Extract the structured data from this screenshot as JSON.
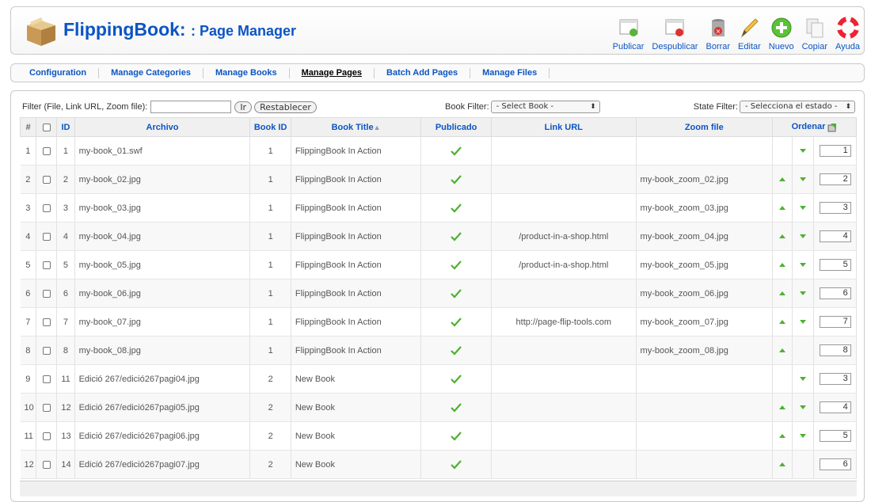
{
  "header": {
    "title": "FlippingBook:",
    "subtitle": ": Page Manager",
    "toolbar": [
      {
        "label": "Publicar",
        "icon": "publish-icon"
      },
      {
        "label": "Despublicar",
        "icon": "unpublish-icon"
      },
      {
        "label": "Borrar",
        "icon": "trash-icon"
      },
      {
        "label": "Editar",
        "icon": "pencil-icon"
      },
      {
        "label": "Nuevo",
        "icon": "plus-circle-icon"
      },
      {
        "label": "Copiar",
        "icon": "copy-icon"
      },
      {
        "label": "Ayuda",
        "icon": "lifebuoy-icon"
      }
    ]
  },
  "submenu": {
    "tabs": [
      {
        "label": "Configuration"
      },
      {
        "label": "Manage Categories"
      },
      {
        "label": "Manage Books"
      },
      {
        "label": "Manage Pages"
      },
      {
        "label": "Batch Add Pages"
      },
      {
        "label": "Manage Files"
      }
    ],
    "active": "Manage Pages"
  },
  "filters": {
    "filter_label": "Filter (File, Link URL, Zoom file):",
    "filter_value": "",
    "go_label": "Ir",
    "reset_label": "Restablecer",
    "book_filter_label": "Book Filter:",
    "book_filter_value": "- Select Book -",
    "state_filter_label": "State Filter:",
    "state_filter_value": "- Selecciona el estado -"
  },
  "table": {
    "headers": {
      "num": "#",
      "id": "ID",
      "file": "Archivo",
      "book_id": "Book ID",
      "book_title": "Book Title",
      "published": "Publicado",
      "link_url": "Link URL",
      "zoom_file": "Zoom file",
      "order": "Ordenar"
    },
    "rows": [
      {
        "num": "1",
        "id": "1",
        "file": "my-book_01.swf",
        "book_id": "1",
        "book_title": "FlippingBook In Action",
        "link_url": "",
        "zoom_file": "",
        "up": false,
        "down": true,
        "order": "1"
      },
      {
        "num": "2",
        "id": "2",
        "file": "my-book_02.jpg",
        "book_id": "1",
        "book_title": "FlippingBook In Action",
        "link_url": "",
        "zoom_file": "my-book_zoom_02.jpg",
        "up": true,
        "down": true,
        "order": "2"
      },
      {
        "num": "3",
        "id": "3",
        "file": "my-book_03.jpg",
        "book_id": "1",
        "book_title": "FlippingBook In Action",
        "link_url": "",
        "zoom_file": "my-book_zoom_03.jpg",
        "up": true,
        "down": true,
        "order": "3"
      },
      {
        "num": "4",
        "id": "4",
        "file": "my-book_04.jpg",
        "book_id": "1",
        "book_title": "FlippingBook In Action",
        "link_url": "/product-in-a-shop.html",
        "zoom_file": "my-book_zoom_04.jpg",
        "up": true,
        "down": true,
        "order": "4"
      },
      {
        "num": "5",
        "id": "5",
        "file": "my-book_05.jpg",
        "book_id": "1",
        "book_title": "FlippingBook In Action",
        "link_url": "/product-in-a-shop.html",
        "zoom_file": "my-book_zoom_05.jpg",
        "up": true,
        "down": true,
        "order": "5"
      },
      {
        "num": "6",
        "id": "6",
        "file": "my-book_06.jpg",
        "book_id": "1",
        "book_title": "FlippingBook In Action",
        "link_url": "",
        "zoom_file": "my-book_zoom_06.jpg",
        "up": true,
        "down": true,
        "order": "6"
      },
      {
        "num": "7",
        "id": "7",
        "file": "my-book_07.jpg",
        "book_id": "1",
        "book_title": "FlippingBook In Action",
        "link_url": "http://page-flip-tools.com",
        "zoom_file": "my-book_zoom_07.jpg",
        "up": true,
        "down": true,
        "order": "7"
      },
      {
        "num": "8",
        "id": "8",
        "file": "my-book_08.jpg",
        "book_id": "1",
        "book_title": "FlippingBook In Action",
        "link_url": "",
        "zoom_file": "my-book_zoom_08.jpg",
        "up": true,
        "down": false,
        "order": "8"
      },
      {
        "num": "9",
        "id": "11",
        "file": "Edició 267/edició267pagi04.jpg",
        "book_id": "2",
        "book_title": "New Book",
        "link_url": "",
        "zoom_file": "",
        "up": false,
        "down": true,
        "order": "3"
      },
      {
        "num": "10",
        "id": "12",
        "file": "Edició 267/edició267pagi05.jpg",
        "book_id": "2",
        "book_title": "New Book",
        "link_url": "",
        "zoom_file": "",
        "up": true,
        "down": true,
        "order": "4"
      },
      {
        "num": "11",
        "id": "13",
        "file": "Edició 267/edició267pagi06.jpg",
        "book_id": "2",
        "book_title": "New Book",
        "link_url": "",
        "zoom_file": "",
        "up": true,
        "down": true,
        "order": "5"
      },
      {
        "num": "12",
        "id": "14",
        "file": "Edició 267/edició267pagi07.jpg",
        "book_id": "2",
        "book_title": "New Book",
        "link_url": "",
        "zoom_file": "",
        "up": true,
        "down": false,
        "order": "6"
      }
    ]
  },
  "colors": {
    "link": "#0b55c4",
    "check": "#4db132"
  }
}
